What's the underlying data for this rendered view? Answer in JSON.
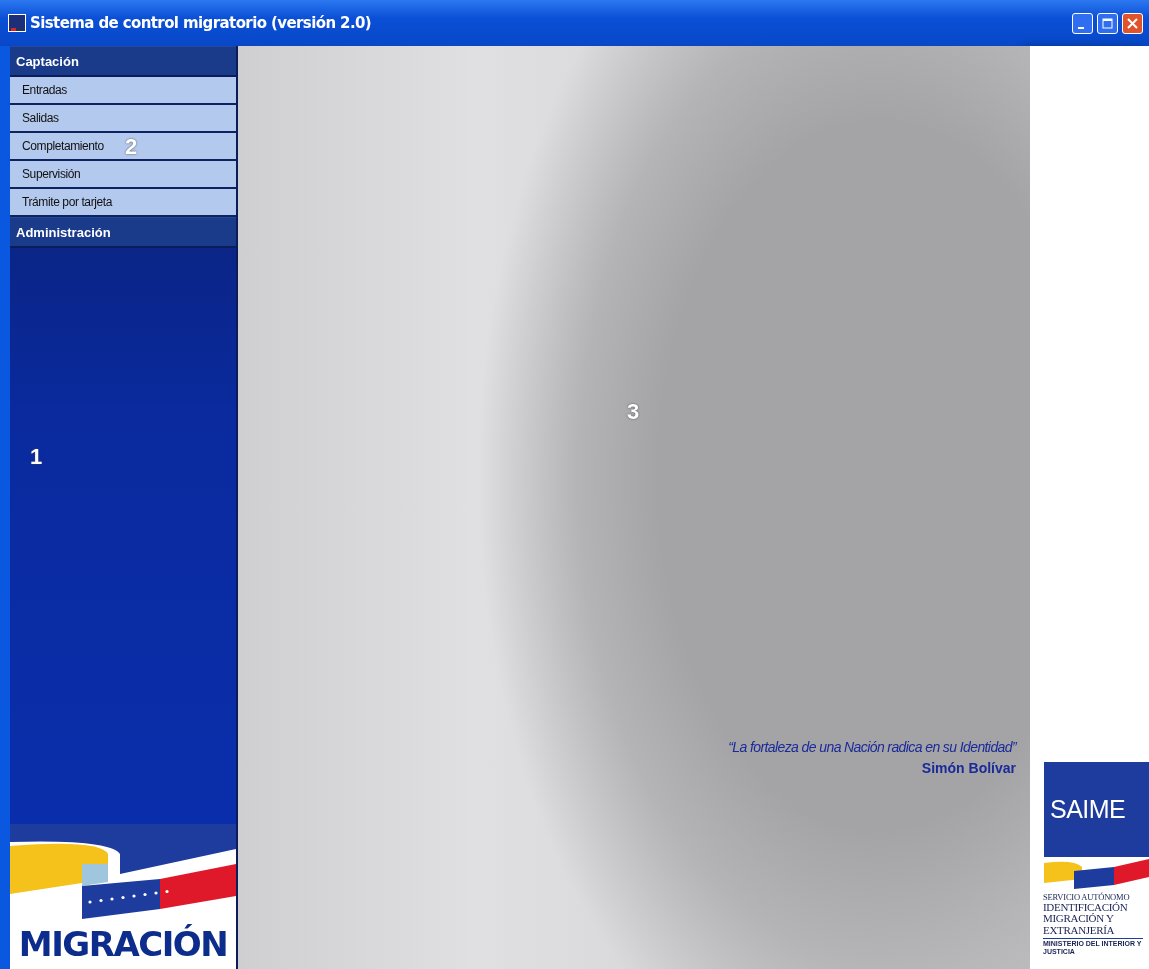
{
  "window": {
    "title": "Sistema de control migratorio (versión 2.0)"
  },
  "sidebar": {
    "groups": [
      {
        "label": "Captación",
        "items": [
          "Entradas",
          "Salidas",
          "Completamiento",
          "Supervisión",
          "Trámite por tarjeta"
        ]
      },
      {
        "label": "Administración"
      }
    ],
    "logo": {
      "text": "MIGRACIÓN"
    }
  },
  "main": {
    "quote": "“La fortaleza de una Nación radica en su Identidad”",
    "author": "Simón Bolívar"
  },
  "right_panel": {
    "logo": {
      "title": "SAIME",
      "lines": [
        "SERVICIO AUTÓNOMO",
        "IDENTIFICACIÓN",
        "MIGRACIÓN Y",
        "EXTRANJERÍA"
      ],
      "footer": "MINISTERIO DEL INTERIOR Y JUSTICIA"
    }
  },
  "callouts": [
    "1",
    "2",
    "3"
  ]
}
